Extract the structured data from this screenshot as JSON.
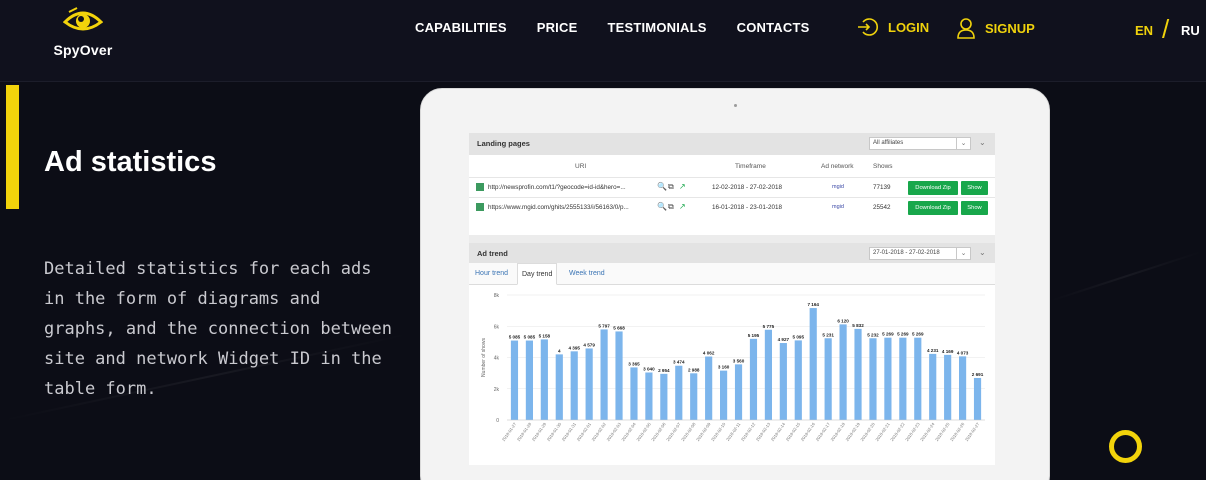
{
  "header": {
    "logo_text": "SpyOver",
    "nav": [
      "CAPABILITIES",
      "PRICE",
      "TESTIMONIALS",
      "CONTACTS"
    ],
    "login_label": "LOGIN",
    "signup_label": "SIGNUP",
    "lang_en": "EN",
    "lang_sep": "/",
    "lang_ru": "RU",
    "accent_color": "#f2d30b"
  },
  "hero": {
    "title": "Ad statistics",
    "description": "Detailed statistics for each ads in the form of diagrams and graphs, and the connection between site and network Widget ID in the table form."
  },
  "landing_pages": {
    "title": "Landing pages",
    "filter_value": "All affiliates",
    "columns": [
      "URI",
      "Timeframe",
      "Ad network",
      "Shows"
    ],
    "rows": [
      {
        "uri": "http://newsprofin.com/t1/?geocode=id-id&hero=...",
        "timeframe": "12-02-2018 - 27-02-2018",
        "network": "mgid",
        "shows": "77139",
        "zip_label": "Download Zip",
        "show_label": "Show"
      },
      {
        "uri": "https://www.mgid.com/ghits/2555133/i/56163/0/p...",
        "timeframe": "16-01-2018 - 23-01-2018",
        "network": "mgid",
        "shows": "25542",
        "zip_label": "Download Zip",
        "show_label": "Show"
      }
    ]
  },
  "ad_trend": {
    "title": "Ad trend",
    "date_range": "27-01-2018 - 27-02-2018",
    "tabs": [
      "Hour trend",
      "Day trend",
      "Week trend"
    ],
    "active_tab": "Day trend"
  },
  "chart_data": {
    "type": "bar",
    "ylabel": "Number of shows",
    "ylim": [
      0,
      8000
    ],
    "yticks": [
      "0",
      "2k",
      "4k",
      "6k",
      "8k"
    ],
    "bar_color": "#7cb5ec",
    "categories": [
      "2018-01-27",
      "2018-01-28",
      "2018-01-29",
      "2018-01-30",
      "2018-01-31",
      "2018-02-01",
      "2018-02-02",
      "2018-02-03",
      "2018-02-04",
      "2018-02-05",
      "2018-02-06",
      "2018-02-07",
      "2018-02-08",
      "2018-02-09",
      "2018-02-10",
      "2018-02-11",
      "2018-02-12",
      "2018-02-13",
      "2018-02-14",
      "2018-02-15",
      "2018-02-16",
      "2018-02-17",
      "2018-02-18",
      "2018-02-19",
      "2018-02-20",
      "2018-02-21",
      "2018-02-22",
      "2018-02-23",
      "2018-02-24",
      "2018-02-25",
      "2018-02-26",
      "2018-02-27"
    ],
    "values": [
      5085,
      5085,
      5158,
      4200,
      4395,
      4579,
      5797,
      5668,
      3365,
      3040,
      2954,
      3474,
      2988,
      4062,
      3160,
      3560,
      5195,
      5775,
      4927,
      5095,
      7164,
      5231,
      6120,
      5832,
      5232,
      5269,
      5269,
      5269,
      4231,
      4169,
      4073,
      2691
    ],
    "data_labels": [
      "5 085",
      "5 085",
      "5 158",
      "4 ",
      "4 395",
      "4 579",
      "5 797",
      "5 668",
      "3 365",
      "3 040",
      "2 954",
      "3 474",
      "2 988",
      "4 062",
      "3 160",
      "3 560",
      "5 195",
      "5 775",
      "4 927",
      "5 095",
      "7 164",
      "5 231",
      "6 120",
      "5 832",
      "5 232",
      "5 269",
      "5 269",
      "5 269",
      "4 231",
      "4 169",
      "4 073",
      "2 691"
    ]
  }
}
